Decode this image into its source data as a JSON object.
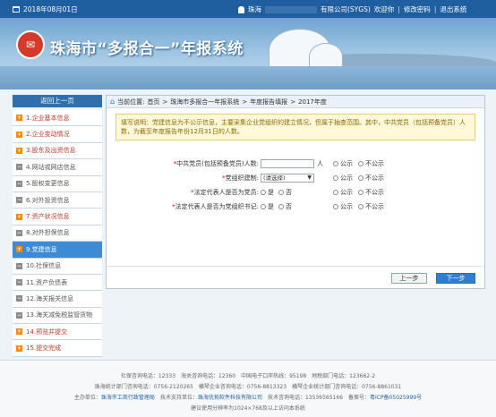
{
  "topbar": {
    "date": "2018年08月01日",
    "user_prefix": "珠海",
    "user_suffix": "有限公司(SYGS)",
    "welcome": "欢迎你",
    "change_password": "修改密码",
    "logout": "退出系统"
  },
  "banner": {
    "title": "珠海市“多报合一”年报系统"
  },
  "sidebar": {
    "back_label": "返回上一页",
    "items": [
      {
        "label": "1.企业基本信息",
        "state": "done"
      },
      {
        "label": "2.企业变动情况",
        "state": "done"
      },
      {
        "label": "3.股东及出资信息",
        "state": "done"
      },
      {
        "label": "4.网站或网店信息",
        "state": "todo"
      },
      {
        "label": "5.股权变更信息",
        "state": "todo"
      },
      {
        "label": "6.对外投资信息",
        "state": "todo"
      },
      {
        "label": "7.资产状况信息",
        "state": "done"
      },
      {
        "label": "8.对外担保信息",
        "state": "todo"
      },
      {
        "label": "9.党建信息",
        "state": "active"
      },
      {
        "label": "10.社保信息",
        "state": "todo"
      },
      {
        "label": "11.资产负债表",
        "state": "todo"
      },
      {
        "label": "12.海关报关信息",
        "state": "todo"
      },
      {
        "label": "13.海关减免税监管货物",
        "state": "todo"
      },
      {
        "label": "14.预览并提交",
        "state": "done"
      },
      {
        "label": "15.提交完成",
        "state": "done"
      }
    ]
  },
  "breadcrumb": {
    "prefix": "当前位置:",
    "items": [
      "首页",
      "珠海市多报合一年报系统",
      "年度报告填报",
      "2017年度"
    ]
  },
  "notice": "填写说明：党建信息为不公示信息，主要采集企业党组织的建立情况，但属于抽查范围。其中，中共党员（包括预备党员）人数，为截至年度报告年份12月31日的人数。",
  "form": {
    "rows": [
      {
        "label": "中共党员(包括预备党员)人数:",
        "control": "input",
        "unit": "人",
        "value": ""
      },
      {
        "label": "党组织建制:",
        "control": "select",
        "value": "(请选择)"
      },
      {
        "label": "法定代表人是否为党员:",
        "control": "yesno",
        "yes": "是",
        "no": "否"
      },
      {
        "label": "法定代表人是否为党组织书记:",
        "control": "yesno",
        "yes": "是",
        "no": "否"
      }
    ],
    "public_label": "公示",
    "private_label": "不公示"
  },
  "buttons": {
    "prev": "上一步",
    "next": "下一步"
  },
  "footer": {
    "line1": "社保咨询电话：12333　海关咨询电话：12360　中国电子口岸热线：95198　地税部门电话：123662-2",
    "line2": "珠海统计部门咨询电话：0756-2120265　横琴企业咨询电话：0756-8813323　横琴企业统计部门咨询电话：0756-8861031",
    "line3_a": "主办单位：",
    "line3_b": "珠海市工商行政管理局",
    "line3_c": "技术支持单位：",
    "line3_d": "珠海优拓软件科技有限公司",
    "line3_e": "技术咨询电话：13536565166　备案号：",
    "line3_f": "粤ICP备05025999号",
    "line4": "建议使用分辨率为1024×768及以上访问本系统"
  }
}
